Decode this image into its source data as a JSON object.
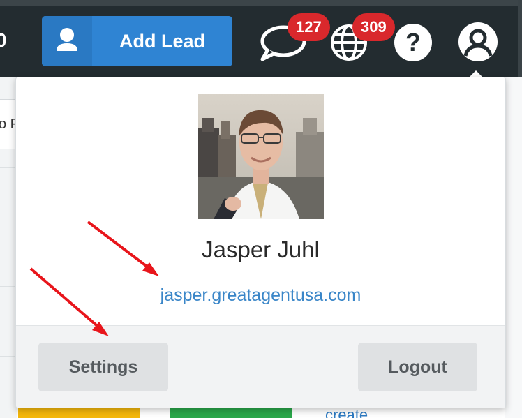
{
  "nav": {
    "edge_number": "0",
    "add_lead_label": "Add Lead",
    "messages_count": "127",
    "notifications_count": "309",
    "icons": [
      "user-add-icon",
      "chat-bubble-icon",
      "globe-icon",
      "help-icon",
      "account-icon"
    ]
  },
  "background": {
    "input_fragment": "o F",
    "link_fragment": "create"
  },
  "profile": {
    "name": "Jasper Juhl",
    "website": "jasper.greatagentusa.com",
    "settings_label": "Settings",
    "logout_label": "Logout"
  },
  "annotations": {
    "arrow_color": "#e8151b",
    "arrows": [
      "points-to-website-link",
      "points-to-settings-button"
    ]
  },
  "colors": {
    "topbar": "#232c30",
    "accent_blue": "#2f84d3",
    "badge_red": "#d9282c",
    "link_blue": "#3a86c8"
  }
}
